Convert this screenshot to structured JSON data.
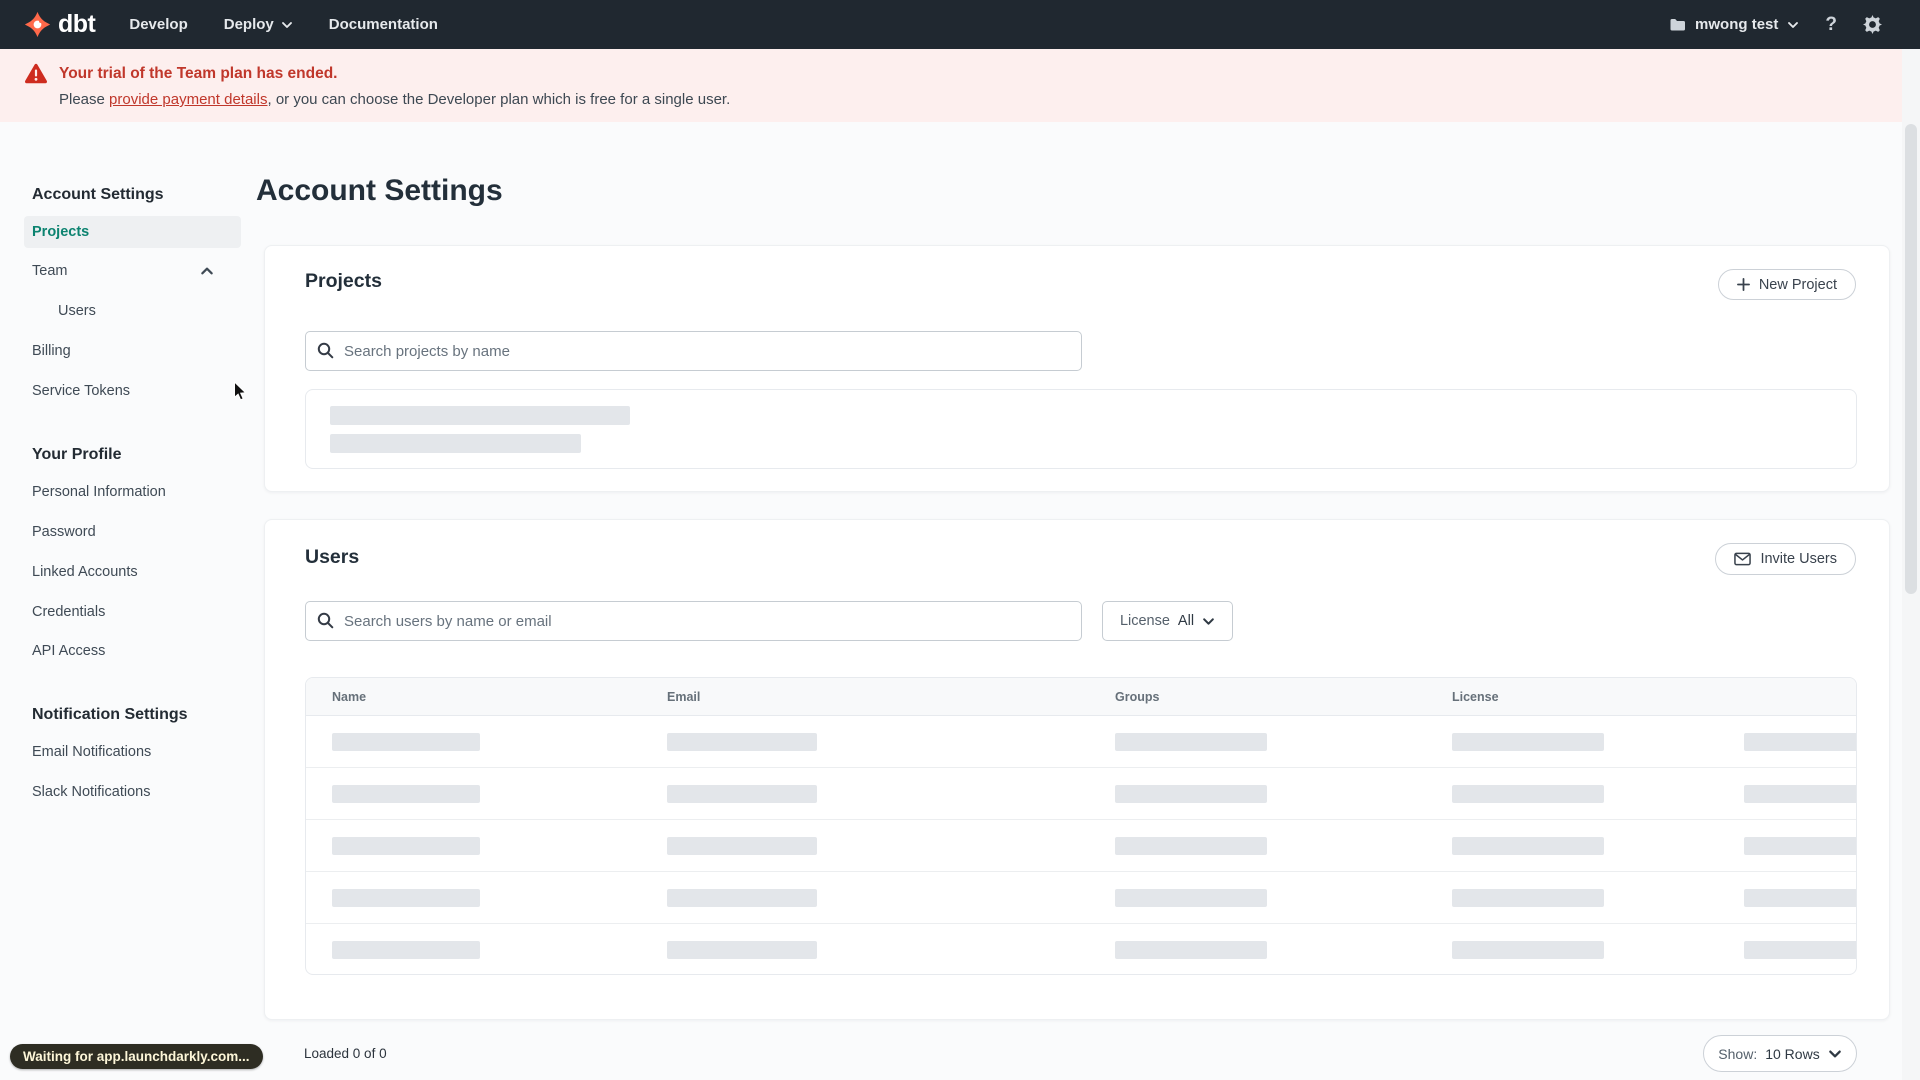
{
  "colors": {
    "brand_orange": "#FF694A",
    "accent_teal": "#0C8370",
    "banner_red": "#C0372B",
    "nav_bg": "#202830"
  },
  "nav": {
    "logo": "dbt",
    "develop": "Develop",
    "deploy": "Deploy",
    "documentation": "Documentation",
    "account_name": "mwong test",
    "help": "?"
  },
  "banner": {
    "title": "Your trial of the Team plan has ended.",
    "body_prefix": "Please ",
    "link_text": "provide payment details",
    "body_suffix": ", or you can choose the Developer plan which is free for a single user."
  },
  "sidebar": {
    "account_settings_header": "Account Settings",
    "projects": "Projects",
    "team": "Team",
    "users": "Users",
    "billing": "Billing",
    "service_tokens": "Service Tokens",
    "your_profile_header": "Your Profile",
    "personal_information": "Personal Information",
    "password": "Password",
    "linked_accounts": "Linked Accounts",
    "credentials": "Credentials",
    "api_access": "API Access",
    "notification_settings_header": "Notification Settings",
    "email_notifications": "Email Notifications",
    "slack_notifications": "Slack Notifications"
  },
  "main": {
    "title": "Account Settings"
  },
  "projects": {
    "title": "Projects",
    "new_button": "New Project",
    "search_placeholder": "Search projects by name"
  },
  "users": {
    "title": "Users",
    "invite_button": "Invite Users",
    "search_placeholder": "Search users by name or email",
    "license_label": "License",
    "license_value": "All",
    "columns": [
      "Name",
      "Email",
      "Groups",
      "License"
    ],
    "loaded_text": "Loaded 0 of 0",
    "show_label": "Show:",
    "show_value": "10 Rows"
  },
  "status_bubble": "Waiting for app.launchdarkly.com..."
}
